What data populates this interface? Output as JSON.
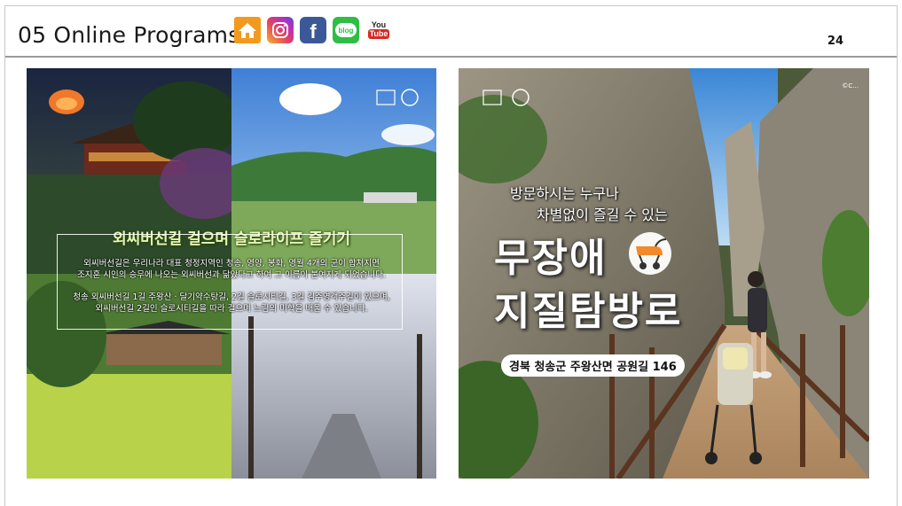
{
  "header": {
    "title": "05 Online Programs",
    "page_number": "24",
    "social_icons": [
      "home-icon",
      "instagram-icon",
      "facebook-icon",
      "blog-icon",
      "youtube-icon"
    ],
    "blog_label": "blog",
    "youtube_label_top": "You",
    "youtube_label_bottom": "Tube",
    "facebook_label": "f"
  },
  "left_poster": {
    "title": "외씨버선길 걸으며 슬로라이프 즐기기",
    "paragraph_1": [
      "외씨버선길은 우리나라 대표 청정지역인 청송, 영양, 봉화, 영월 4개의 군이 합쳐지면",
      "조지훈 시인의 승무에 나오는 외씨버선과 닮았다고 하여 그 이름이 붙여지게 되었습니다."
    ],
    "paragraph_2": [
      "청송 외씨버선길 1길 주왕산 · 달기약수탕길, 2길 슬로시티길, 3길 김주영객주길이 있으며,",
      "외씨버선길 2길인 슬로시티길을 따라 걸으며 느림의 미학을 배울 수 있습니다."
    ],
    "colors": {
      "accent": "#e9f7b6"
    }
  },
  "right_poster": {
    "subtitle_line_1": "방문하시는 누구나",
    "subtitle_line_2": "차별없이 즐길 수 있는",
    "headline_1": "무장애",
    "headline_2": "지질탐방로",
    "address": "경북 청송군 주왕산면 공원길 146",
    "credit": "©C...",
    "icons": [
      "stroller-icon"
    ]
  }
}
